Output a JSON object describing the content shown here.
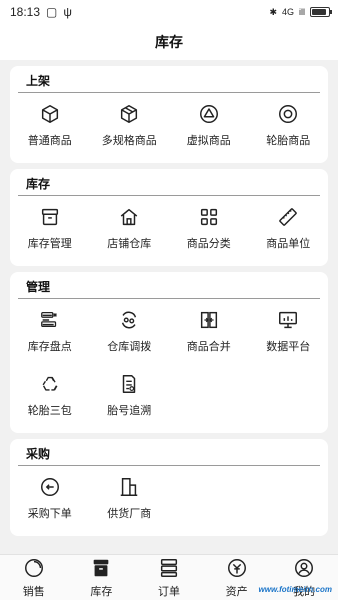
{
  "status_bar": {
    "time": "18:13",
    "network": "4G",
    "signal": "ill"
  },
  "header": {
    "title": "库存"
  },
  "sections": [
    {
      "title": "上架",
      "items": [
        {
          "label": "普通商品",
          "icon": "cube-icon"
        },
        {
          "label": "多规格商品",
          "icon": "multi-cube-icon"
        },
        {
          "label": "虚拟商品",
          "icon": "triangle-circle-icon"
        },
        {
          "label": "轮胎商品",
          "icon": "tire-icon"
        }
      ]
    },
    {
      "title": "库存",
      "items": [
        {
          "label": "库存管理",
          "icon": "box-icon"
        },
        {
          "label": "店铺仓库",
          "icon": "home-icon"
        },
        {
          "label": "商品分类",
          "icon": "grid-icon"
        },
        {
          "label": "商品单位",
          "icon": "ruler-icon"
        }
      ]
    },
    {
      "title": "管理",
      "items": [
        {
          "label": "库存盘点",
          "icon": "checklist-icon"
        },
        {
          "label": "仓库调拨",
          "icon": "transfer-icon"
        },
        {
          "label": "商品合并",
          "icon": "merge-icon"
        },
        {
          "label": "数据平台",
          "icon": "monitor-chart-icon"
        },
        {
          "label": "轮胎三包",
          "icon": "recycle-icon"
        },
        {
          "label": "胎号追溯",
          "icon": "document-search-icon"
        }
      ]
    },
    {
      "title": "采购",
      "items": [
        {
          "label": "采购下单",
          "icon": "purchase-order-icon"
        },
        {
          "label": "供货厂商",
          "icon": "factory-icon"
        }
      ]
    }
  ],
  "tabbar": [
    {
      "label": "销售",
      "icon": "sales-icon"
    },
    {
      "label": "库存",
      "icon": "inventory-icon"
    },
    {
      "label": "订单",
      "icon": "orders-icon"
    },
    {
      "label": "资产",
      "icon": "assets-icon"
    },
    {
      "label": "我的",
      "icon": "profile-icon"
    }
  ],
  "watermark": "www.fotimeirn.com"
}
